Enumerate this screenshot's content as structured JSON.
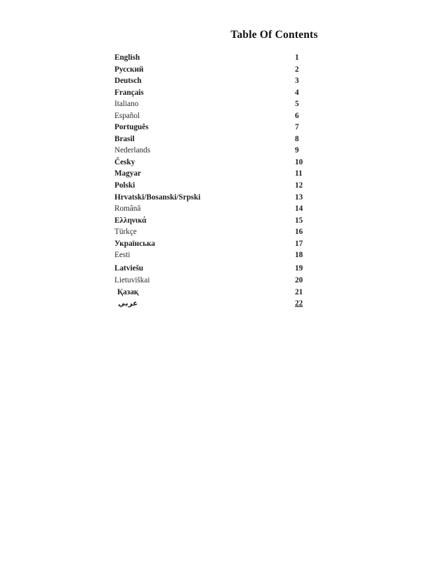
{
  "document": {
    "title": "Table Of Contents",
    "background_color": "#ffffff",
    "text_color": "#1c1c1c"
  },
  "toc": {
    "entries": [
      {
        "label": "English",
        "page": "1",
        "weight": "semi",
        "script": "latin"
      },
      {
        "label": "Русский",
        "page": "2",
        "weight": "bold",
        "script": "cyrillic"
      },
      {
        "label": "Deutsch",
        "page": "3",
        "weight": "semi",
        "script": "latin"
      },
      {
        "label": "Français",
        "page": "4",
        "weight": "semi",
        "script": "latin"
      },
      {
        "label": "Italiano",
        "page": "5",
        "weight": "reg",
        "script": "latin"
      },
      {
        "label": "Español",
        "page": "6",
        "weight": "reg",
        "script": "latin"
      },
      {
        "label": "Português",
        "page": "7",
        "weight": "bold",
        "script": "latin"
      },
      {
        "label": "Brasil",
        "page": "8",
        "weight": "semi",
        "script": "latin"
      },
      {
        "label": "Nederlands",
        "page": "9",
        "weight": "reg",
        "script": "latin"
      },
      {
        "label": "Česky",
        "page": "10",
        "weight": "bold",
        "script": "latin"
      },
      {
        "label": "Magyar",
        "page": "11",
        "weight": "bold",
        "script": "latin"
      },
      {
        "label": "Polski",
        "page": "12",
        "weight": "bold",
        "script": "latin"
      },
      {
        "label": "Hrvatski/Bosanski/Srpski",
        "page": "13",
        "weight": "bold",
        "script": "latin"
      },
      {
        "label": "Română",
        "page": "14",
        "weight": "reg",
        "script": "latin"
      },
      {
        "label": "Ελληνικά",
        "page": "15",
        "weight": "bold",
        "script": "greek"
      },
      {
        "label": "Türkçe",
        "page": "16",
        "weight": "reg",
        "script": "latin"
      },
      {
        "label": "Українська",
        "page": "17",
        "weight": "bold",
        "script": "cyrillic"
      },
      {
        "label": "Eesti",
        "page": "18",
        "weight": "reg",
        "script": "latin"
      },
      {
        "label": "Latviešu",
        "page": "19",
        "weight": "semi",
        "script": "latin"
      },
      {
        "label": "Lietuviškai",
        "page": "20",
        "weight": "reg",
        "script": "latin"
      },
      {
        "label": "Қазақ",
        "page": "21",
        "weight": "bold",
        "script": "cyrillic"
      },
      {
        "label": "عربي",
        "page": "22",
        "weight": "semi",
        "script": "arabic"
      }
    ]
  }
}
